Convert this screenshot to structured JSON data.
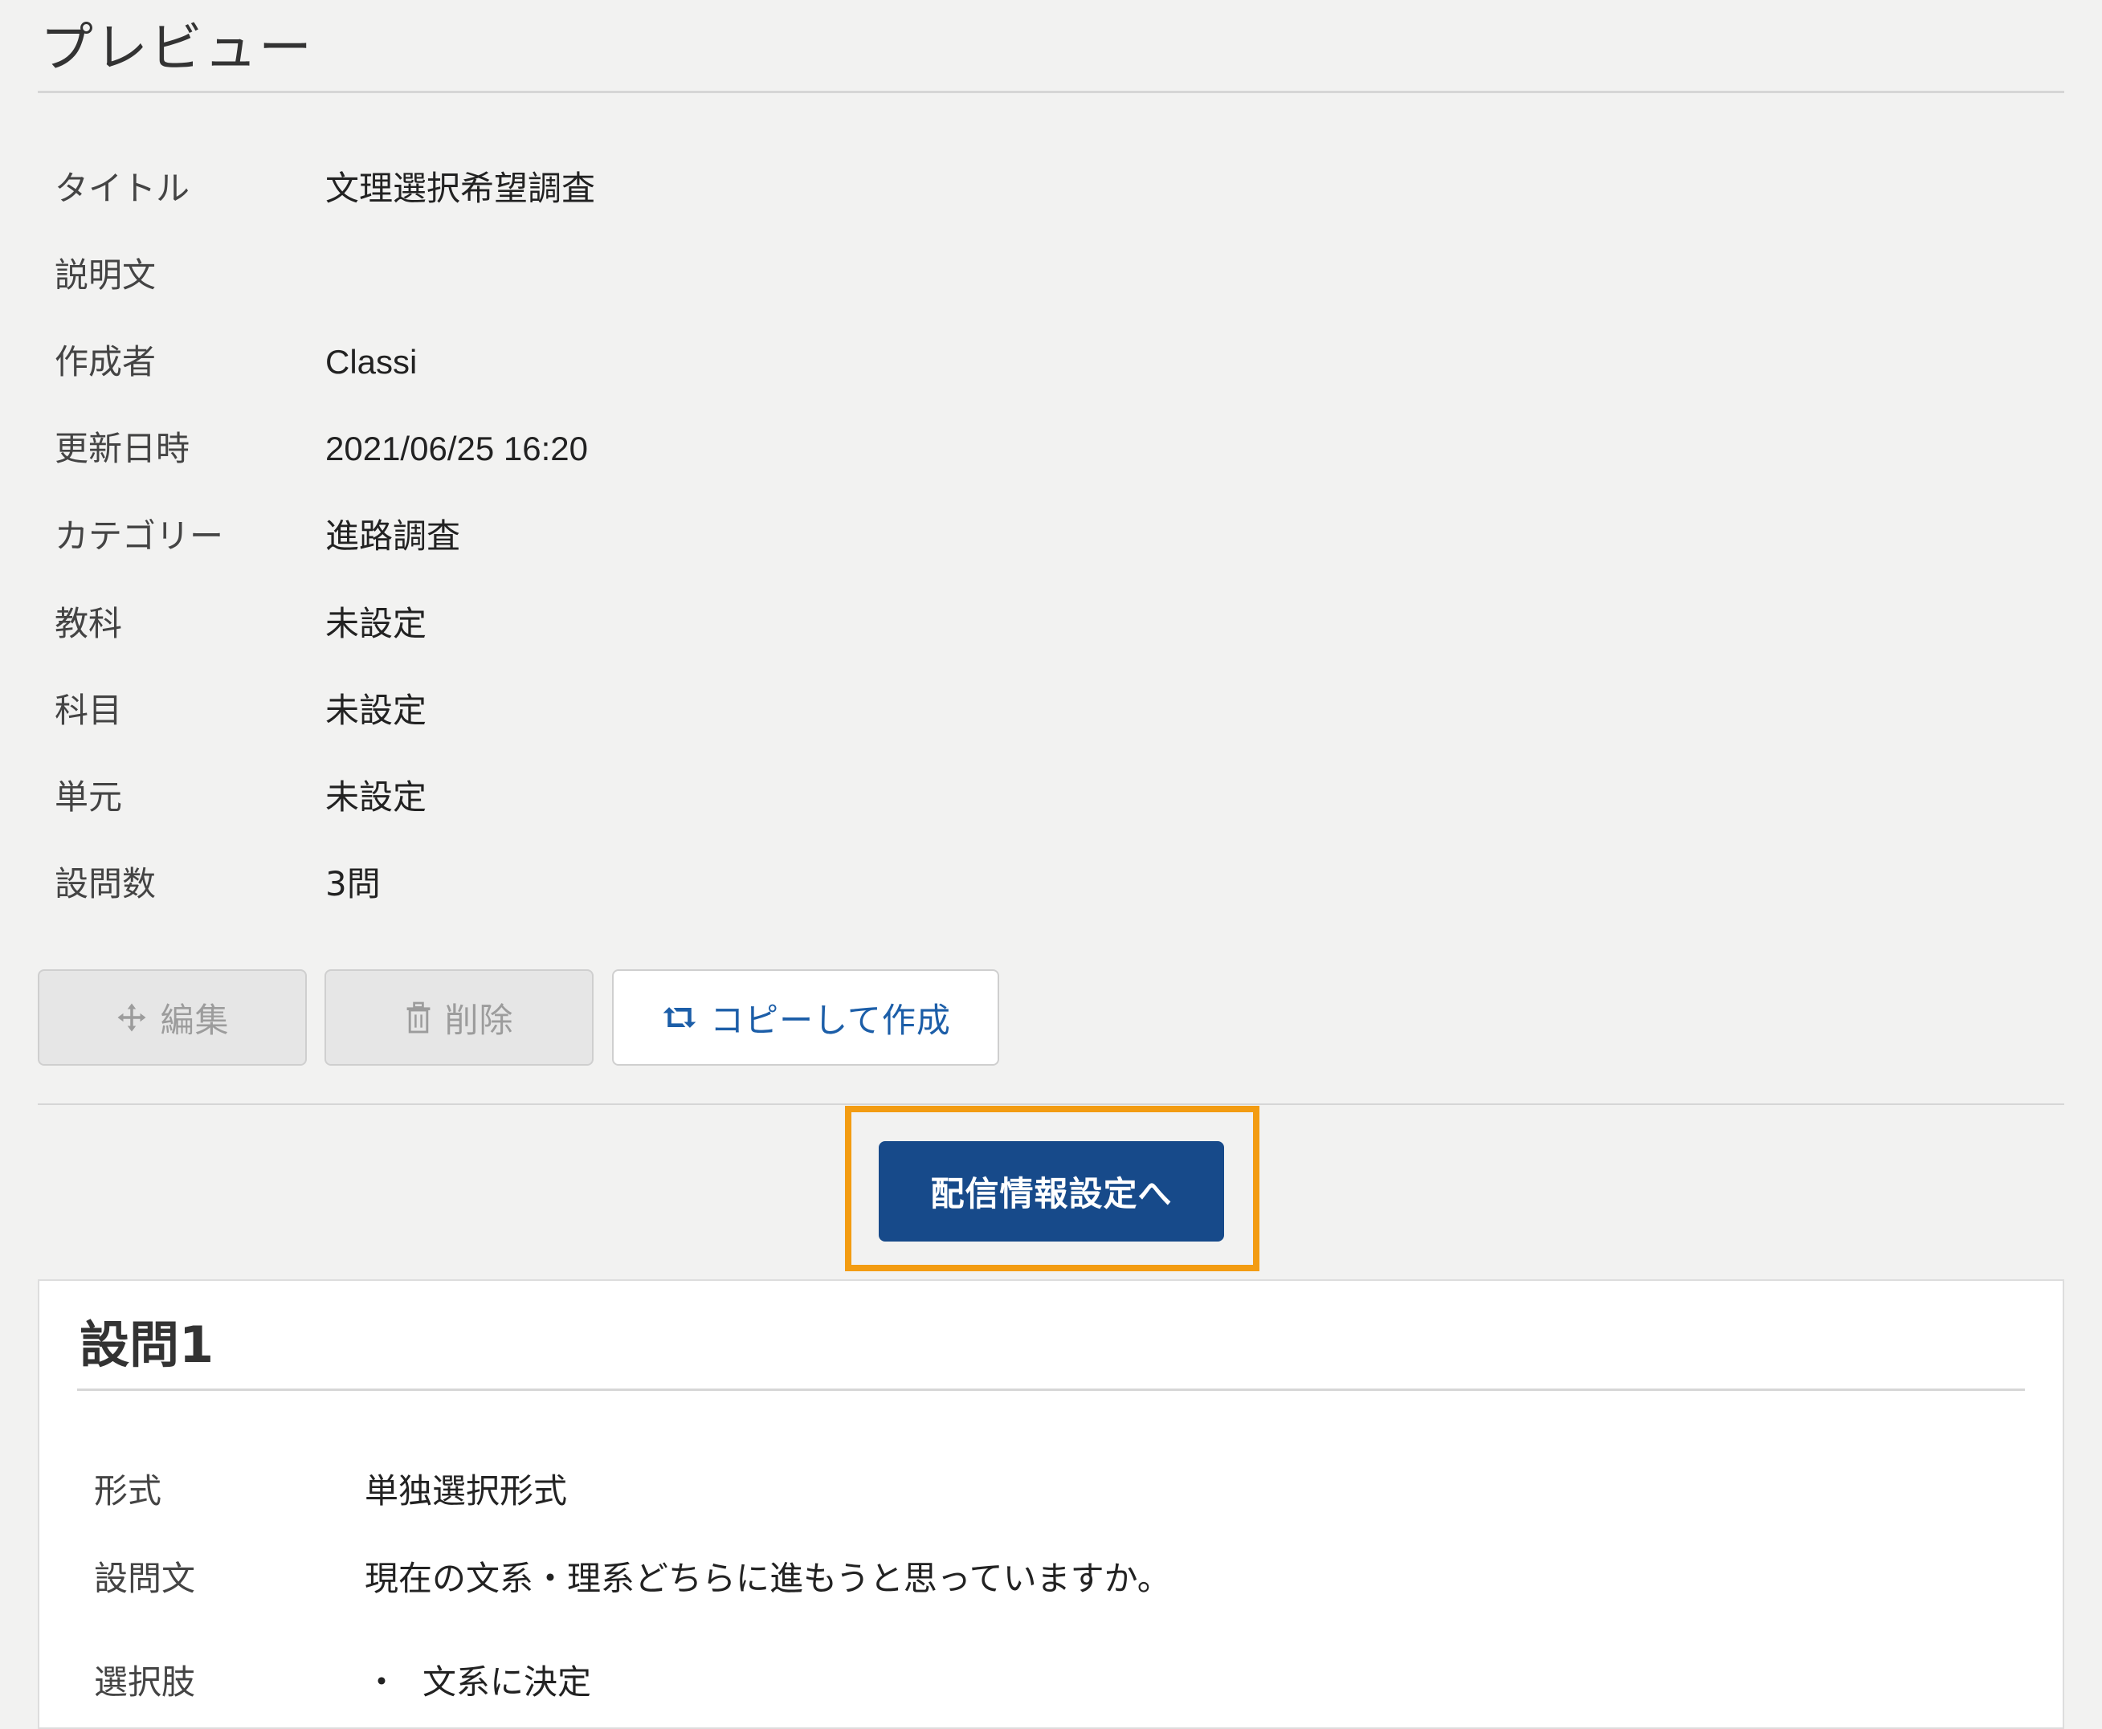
{
  "header": {
    "title": "プレビュー"
  },
  "details": [
    {
      "label": "タイトル",
      "value": "文理選択希望調査"
    },
    {
      "label": "説明文",
      "value": ""
    },
    {
      "label": "作成者",
      "value": "Classi"
    },
    {
      "label": "更新日時",
      "value": "2021/06/25 16:20"
    },
    {
      "label": "カテゴリー",
      "value": "進路調査"
    },
    {
      "label": "教科",
      "value": "未設定"
    },
    {
      "label": "科目",
      "value": "未設定"
    },
    {
      "label": "単元",
      "value": "未設定"
    },
    {
      "label": "設問数",
      "value": "3問"
    }
  ],
  "actions": {
    "edit_label": "編集",
    "delete_label": "削除",
    "copy_label": "コピーして作成",
    "edit_icon": "move-icon",
    "delete_icon": "trash-icon",
    "copy_icon": "retweet-icon"
  },
  "primary_action": {
    "label": "配信情報設定へ"
  },
  "question": {
    "title": "設問1",
    "rows": [
      {
        "label": "形式",
        "value": "単独選択形式"
      },
      {
        "label": "設問文",
        "value": "現在の文系・理系どちらに進もうと思っていますか。"
      },
      {
        "label": "選択肢",
        "bullet": "・",
        "value": "文系に決定"
      }
    ]
  },
  "colors": {
    "accent_blue": "#174a8a",
    "link_blue": "#1c5ea8",
    "highlight_orange": "#f39c12",
    "background": "#f2f2f1"
  }
}
